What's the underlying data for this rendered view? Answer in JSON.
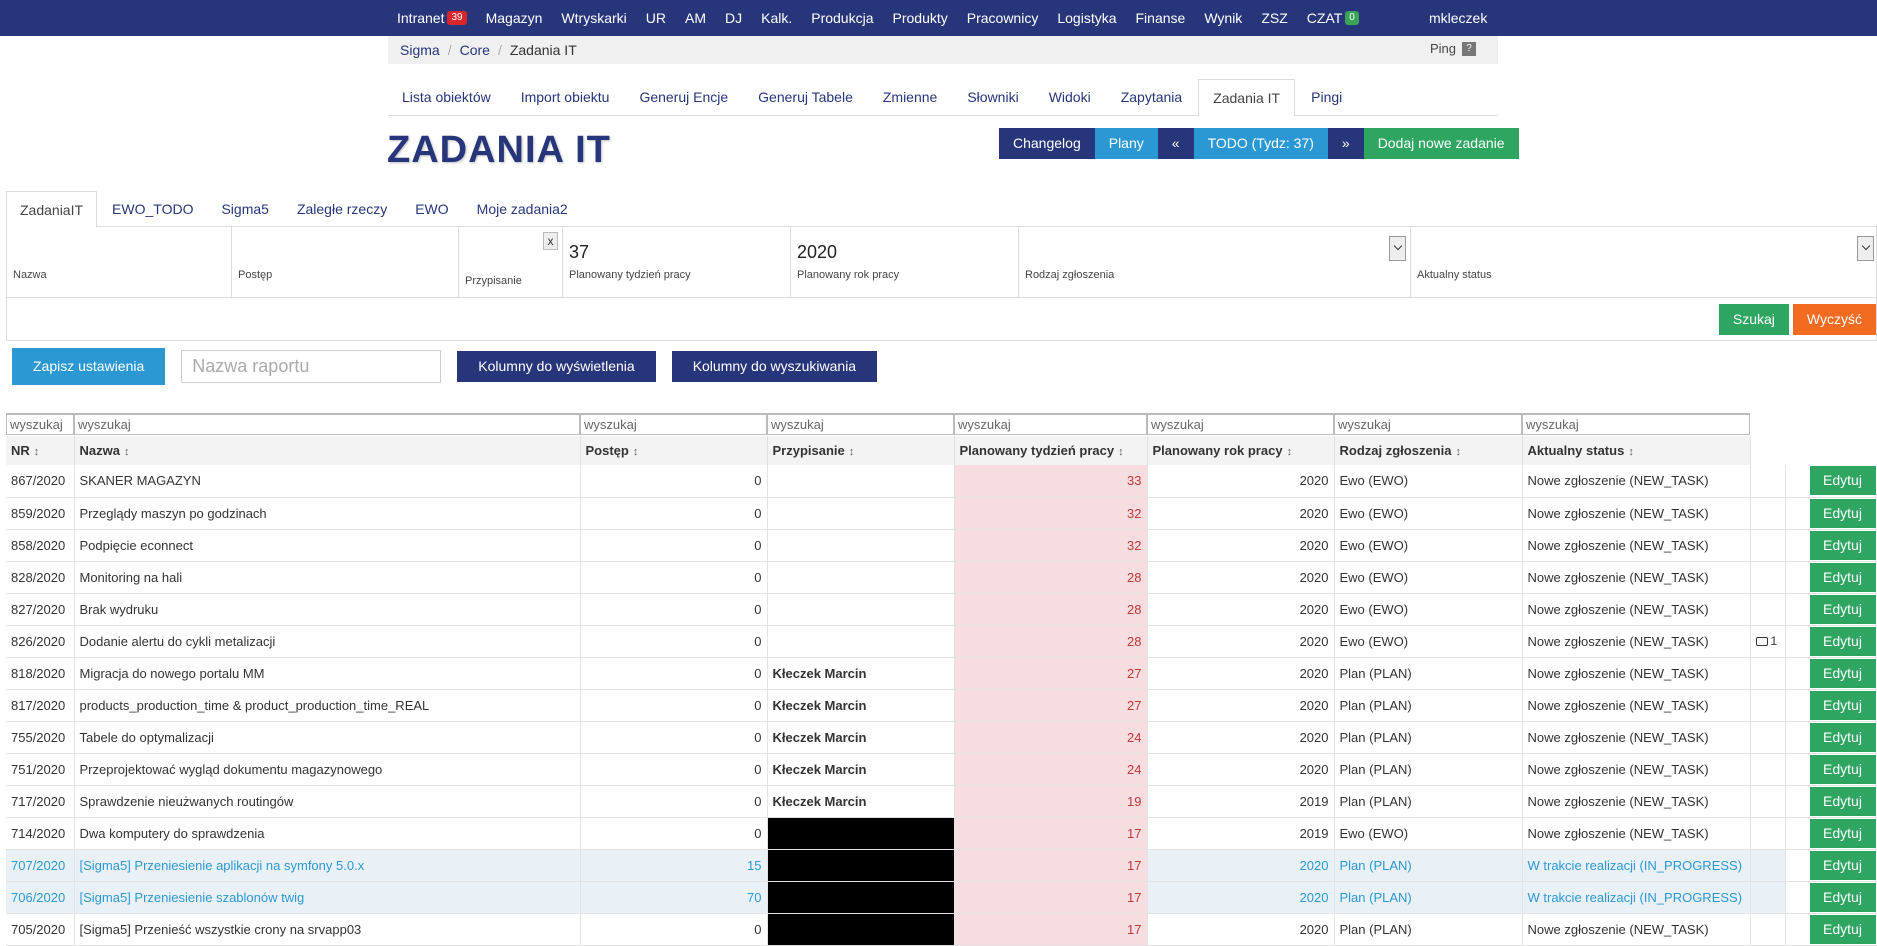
{
  "topnav": {
    "items": [
      {
        "label": "Intranet",
        "badge": "39",
        "badge_color": "#d9262d"
      },
      {
        "label": "Magazyn"
      },
      {
        "label": "Wtryskarki"
      },
      {
        "label": "UR"
      },
      {
        "label": "AM"
      },
      {
        "label": "DJ"
      },
      {
        "label": "Kalk."
      },
      {
        "label": "Produkcja"
      },
      {
        "label": "Produkty"
      },
      {
        "label": "Pracownicy"
      },
      {
        "label": "Logistyka"
      },
      {
        "label": "Finanse"
      },
      {
        "label": "Wynik"
      },
      {
        "label": "ZSZ"
      },
      {
        "label": "CZAT",
        "badge": "0",
        "badge_color": "#3aa357"
      }
    ],
    "user": "mkleczek"
  },
  "breadcrumb": {
    "items": [
      "Sigma",
      "Core",
      "Zadania IT"
    ],
    "ping_label": "Ping",
    "ping_help": "?"
  },
  "subtabs": [
    "Lista obiektów",
    "Import obiektu",
    "Generuj Encje",
    "Generuj Tabele",
    "Zmienne",
    "Słowniki",
    "Widoki",
    "Zapytania",
    "Zadania IT",
    "Pingi"
  ],
  "page_title": "ZADANIA IT",
  "actions": {
    "changelog": "Changelog",
    "plany": "Plany",
    "prev": "«",
    "todo": "TODO (Tydz: 37)",
    "next": "»",
    "add": "Dodaj nowe zadanie"
  },
  "filter_tabs": [
    "ZadaniaIT",
    "EWO_TODO",
    "Sigma5",
    "Zaległe rzeczy",
    "EWO",
    "Moje zadania2"
  ],
  "filters": {
    "nazwa": {
      "label": "Nazwa",
      "value": ""
    },
    "postep": {
      "label": "Postęp",
      "value": ""
    },
    "przypisanie": {
      "label": "Przypisanie",
      "clear": "x"
    },
    "tydzien": {
      "label": "Planowany tydzień pracy",
      "value": "37"
    },
    "rok": {
      "label": "Planowany rok pracy",
      "value": "2020"
    },
    "rodzaj": {
      "label": "Rodzaj zgłoszenia",
      "value": ""
    },
    "status": {
      "label": "Aktualny status",
      "value": ""
    },
    "search_btn": "Szukaj",
    "clear_btn": "Wyczyść"
  },
  "report": {
    "save_btn": "Zapisz ustawienia",
    "name_placeholder": "Nazwa raportu",
    "columns_display_btn": "Kolumny do wyświetlenia",
    "columns_search_btn": "Kolumny do wyszukiwania"
  },
  "table": {
    "search_placeholder": "wyszukaj",
    "sort_icon": "↕",
    "headers": [
      "NR",
      "Nazwa",
      "Postęp",
      "Przypisanie",
      "Planowany tydzień pracy",
      "Planowany rok pracy",
      "Rodzaj zgłoszenia",
      "Aktualny status"
    ],
    "edit_label": "Edytuj",
    "rows": [
      {
        "nr": "867/2020",
        "nazwa": "SKANER MAGAZYN",
        "postep": "0",
        "przypisanie": "",
        "tydzien": "33",
        "rok": "2020",
        "rodzaj": "Ewo (EWO)",
        "status": "Nowe zgłoszenie (NEW_TASK)",
        "comments": "",
        "redacted": false,
        "in_progress": false
      },
      {
        "nr": "859/2020",
        "nazwa": "Przeglądy maszyn po godzinach",
        "postep": "0",
        "przypisanie": "",
        "tydzien": "32",
        "rok": "2020",
        "rodzaj": "Ewo (EWO)",
        "status": "Nowe zgłoszenie (NEW_TASK)",
        "comments": "",
        "redacted": false,
        "in_progress": false
      },
      {
        "nr": "858/2020",
        "nazwa": "Podpięcie econnect",
        "postep": "0",
        "przypisanie": "",
        "tydzien": "32",
        "rok": "2020",
        "rodzaj": "Ewo (EWO)",
        "status": "Nowe zgłoszenie (NEW_TASK)",
        "comments": "",
        "redacted": false,
        "in_progress": false
      },
      {
        "nr": "828/2020",
        "nazwa": "Monitoring na hali",
        "postep": "0",
        "przypisanie": "",
        "tydzien": "28",
        "rok": "2020",
        "rodzaj": "Ewo (EWO)",
        "status": "Nowe zgłoszenie (NEW_TASK)",
        "comments": "",
        "redacted": false,
        "in_progress": false
      },
      {
        "nr": "827/2020",
        "nazwa": "Brak wydruku",
        "postep": "0",
        "przypisanie": "",
        "tydzien": "28",
        "rok": "2020",
        "rodzaj": "Ewo (EWO)",
        "status": "Nowe zgłoszenie (NEW_TASK)",
        "comments": "",
        "redacted": false,
        "in_progress": false
      },
      {
        "nr": "826/2020",
        "nazwa": "Dodanie alertu do cykli metalizacji",
        "postep": "0",
        "przypisanie": "",
        "tydzien": "28",
        "rok": "2020",
        "rodzaj": "Ewo (EWO)",
        "status": "Nowe zgłoszenie (NEW_TASK)",
        "comments": "1",
        "redacted": false,
        "in_progress": false
      },
      {
        "nr": "818/2020",
        "nazwa": "Migracja do nowego portalu MM",
        "postep": "0",
        "przypisanie": "Kłeczek Marcin",
        "tydzien": "27",
        "rok": "2020",
        "rodzaj": "Plan (PLAN)",
        "status": "Nowe zgłoszenie (NEW_TASK)",
        "comments": "",
        "redacted": false,
        "in_progress": false
      },
      {
        "nr": "817/2020",
        "nazwa": "products_production_time & product_production_time_REAL",
        "postep": "0",
        "przypisanie": "Kłeczek Marcin",
        "tydzien": "27",
        "rok": "2020",
        "rodzaj": "Plan (PLAN)",
        "status": "Nowe zgłoszenie (NEW_TASK)",
        "comments": "",
        "redacted": false,
        "in_progress": false
      },
      {
        "nr": "755/2020",
        "nazwa": "Tabele do optymalizacji",
        "postep": "0",
        "przypisanie": "Kłeczek Marcin",
        "tydzien": "24",
        "rok": "2020",
        "rodzaj": "Plan (PLAN)",
        "status": "Nowe zgłoszenie (NEW_TASK)",
        "comments": "",
        "redacted": false,
        "in_progress": false
      },
      {
        "nr": "751/2020",
        "nazwa": "Przeprojektować wygląd dokumentu magazynowego",
        "postep": "0",
        "przypisanie": "Kłeczek Marcin",
        "tydzien": "24",
        "rok": "2020",
        "rodzaj": "Plan (PLAN)",
        "status": "Nowe zgłoszenie (NEW_TASK)",
        "comments": "",
        "redacted": false,
        "in_progress": false
      },
      {
        "nr": "717/2020",
        "nazwa": "Sprawdzenie nieużwanych routingów",
        "postep": "0",
        "przypisanie": "Kłeczek Marcin",
        "tydzien": "19",
        "rok": "2019",
        "rodzaj": "Plan (PLAN)",
        "status": "Nowe zgłoszenie (NEW_TASK)",
        "comments": "",
        "redacted": false,
        "in_progress": false
      },
      {
        "nr": "714/2020",
        "nazwa": "Dwa komputery do sprawdzenia",
        "postep": "0",
        "przypisanie": "",
        "tydzien": "17",
        "rok": "2019",
        "rodzaj": "Ewo (EWO)",
        "status": "Nowe zgłoszenie (NEW_TASK)",
        "comments": "",
        "redacted": true,
        "in_progress": false
      },
      {
        "nr": "707/2020",
        "nazwa": "[Sigma5] Przeniesienie aplikacji na symfony 5.0.x",
        "postep": "15",
        "przypisanie": "",
        "tydzien": "17",
        "rok": "2020",
        "rodzaj": "Plan (PLAN)",
        "status": "W trakcie realizacji (IN_PROGRESS)",
        "comments": "",
        "redacted": true,
        "in_progress": true
      },
      {
        "nr": "706/2020",
        "nazwa": "[Sigma5] Przeniesienie szablonów twig",
        "postep": "70",
        "przypisanie": "",
        "tydzien": "17",
        "rok": "2020",
        "rodzaj": "Plan (PLAN)",
        "status": "W trakcie realizacji (IN_PROGRESS)",
        "comments": "",
        "redacted": true,
        "in_progress": true
      },
      {
        "nr": "705/2020",
        "nazwa": "[Sigma5] Przenieść wszystkie crony na srvapp03",
        "postep": "0",
        "przypisanie": "",
        "tydzien": "17",
        "rok": "2020",
        "rodzaj": "Plan (PLAN)",
        "status": "Nowe zgłoszenie (NEW_TASK)",
        "comments": "",
        "redacted": true,
        "in_progress": false
      }
    ]
  },
  "colors": {
    "navy": "#27357a",
    "blue": "#2b98d4",
    "green": "#2ea661",
    "orange": "#f26b21",
    "week_bg": "#f7dde0",
    "week_text": "#c0393b"
  }
}
